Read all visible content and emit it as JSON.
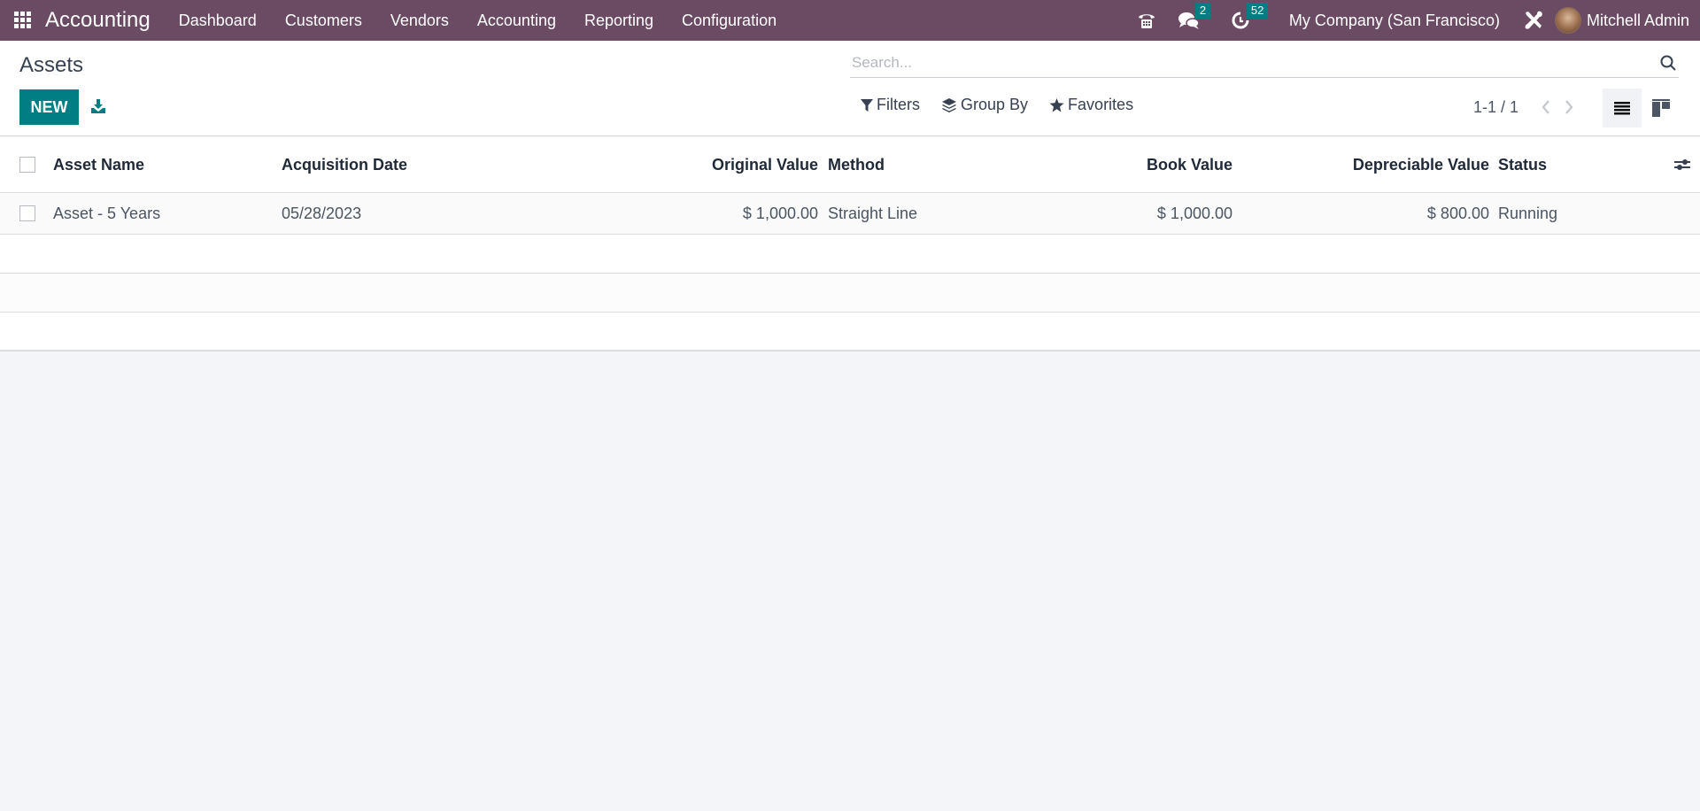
{
  "navbar": {
    "app_name": "Accounting",
    "menu": [
      "Dashboard",
      "Customers",
      "Vendors",
      "Accounting",
      "Reporting",
      "Configuration"
    ],
    "messages_count": "2",
    "activities_count": "52",
    "company": "My Company (San Francisco)",
    "user_name": "Mitchell Admin",
    "icons": {
      "apps": "apps-grid-icon",
      "phone": "phone-icon",
      "messages": "chat-bubbles-icon",
      "activities": "clock-icon",
      "debug": "tools-icon"
    }
  },
  "control_panel": {
    "title": "Assets",
    "new_label": "NEW",
    "download_icon": "download-icon",
    "search_placeholder": "Search...",
    "search_value": "",
    "filters_label": "Filters",
    "group_by_label": "Group By",
    "favorites_label": "Favorites",
    "pager": "1-1 / 1",
    "views": [
      "list",
      "kanban"
    ],
    "active_view": "list"
  },
  "table": {
    "columns": [
      "Asset Name",
      "Acquisition Date",
      "Original Value",
      "Method",
      "Book Value",
      "Depreciable Value",
      "Status"
    ],
    "rows": [
      {
        "asset_name": "Asset - 5 Years",
        "acquisition_date": "05/28/2023",
        "original_value": "$ 1,000.00",
        "method": "Straight Line",
        "book_value": "$ 1,000.00",
        "depreciable_value": "$ 800.00",
        "status": "Running"
      }
    ]
  },
  "colors": {
    "navbar_bg": "#6b4a64",
    "primary": "#017e84",
    "background": "#f4f5f8"
  }
}
